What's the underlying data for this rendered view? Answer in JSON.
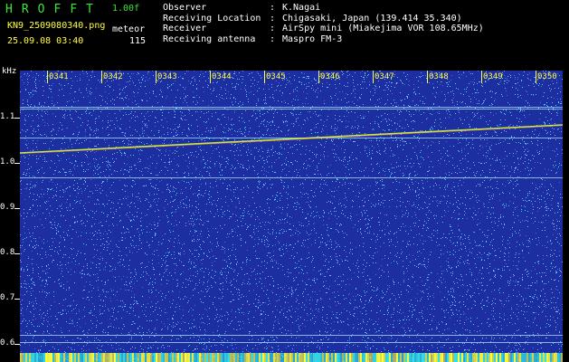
{
  "app": {
    "title_letters": [
      "H",
      "R",
      "O",
      "F",
      "F",
      "T"
    ],
    "version": "1.00f",
    "filename": "KN9_2509080340.png",
    "mode_label": "meteor",
    "datetime": "25.09.08 03:40",
    "count": "115"
  },
  "header": {
    "rows": [
      {
        "key": "Observer",
        "value": "K.Nagai"
      },
      {
        "key": "Receiving Location",
        "value": "Chigasaki, Japan (139.414 35.340)"
      },
      {
        "key": "Receiver",
        "value": "AirSpy mini (Miakejima VOR 108.65MHz)"
      },
      {
        "key": "Receiving antenna",
        "value": "Maspro FM-3"
      }
    ],
    "separator": ":"
  },
  "axis": {
    "y_unit": "kHz",
    "y_ticks": [
      "1.1",
      "1.0",
      "0.9",
      "0.8",
      "0.7",
      "0.6"
    ],
    "x_ticks": [
      "0341",
      "0342",
      "0343",
      "0344",
      "0345",
      "0346",
      "0347",
      "0348",
      "0349",
      "0350"
    ]
  },
  "colors": {
    "background": "#000000",
    "spectrogram_base": "#1c2ea0",
    "noise_light": "#6fb4ff",
    "noise_cyan": "#35e2e6",
    "signal": "#d4ff3c",
    "label_green": "#39e639",
    "label_yellow": "#ffff3c"
  }
}
